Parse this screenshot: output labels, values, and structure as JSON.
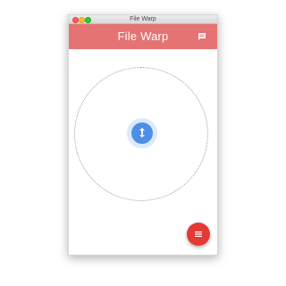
{
  "window": {
    "title": "File Warp",
    "controls": [
      "close",
      "minimize",
      "maximize"
    ]
  },
  "appbar": {
    "title": "File Warp",
    "action_icon": "chat-icon"
  },
  "main": {
    "center_button_icon": "sync-icon",
    "fab_icon": "menu-icon"
  },
  "colors": {
    "appbar": "#e57373",
    "center_button": "#4e8fe6",
    "center_halo": "#dbe9fb",
    "fab": "#e53935"
  }
}
